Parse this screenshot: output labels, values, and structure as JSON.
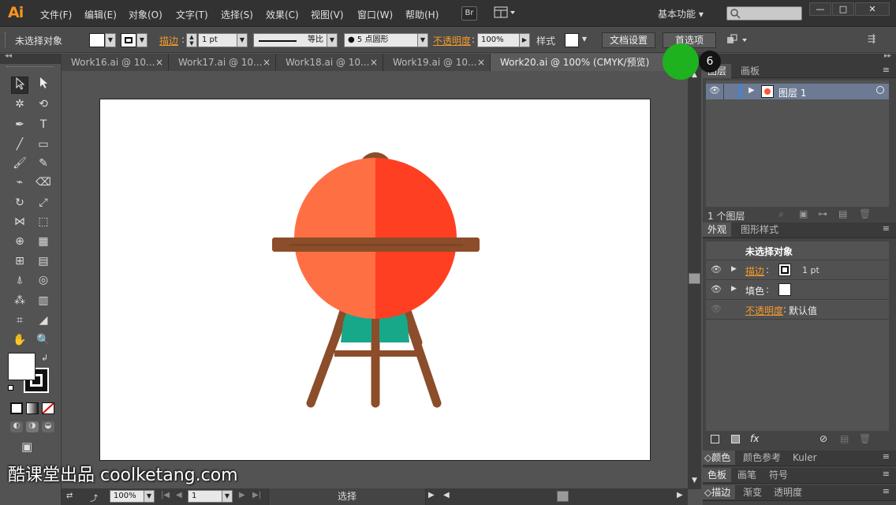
{
  "app": {
    "logo": "Ai",
    "bridge_label": "Br",
    "workspace": "基本功能"
  },
  "menu": [
    "文件(F)",
    "编辑(E)",
    "对象(O)",
    "文字(T)",
    "选择(S)",
    "效果(C)",
    "视图(V)",
    "窗口(W)",
    "帮助(H)"
  ],
  "window_buttons": [
    "—",
    "□",
    "✕"
  ],
  "control": {
    "selection_status": "未选择对象",
    "stroke_label": "描边",
    "stroke_weight": "1 pt",
    "profile_label": "等比",
    "brush_label": "5 点圆形",
    "opacity_label": "不透明度",
    "opacity_value": "100%",
    "style_label": "样式",
    "doc_setup_button": "文档设置",
    "prefs_button": "首选项"
  },
  "tabs": [
    {
      "label": "Work16.ai @ 10...",
      "active": false
    },
    {
      "label": "Work17.ai @ 10...",
      "active": false
    },
    {
      "label": "Work18.ai @ 10...",
      "active": false
    },
    {
      "label": "Work19.ai @ 10...",
      "active": false
    },
    {
      "label": "Work20.ai @ 100% (CMYK/预览)",
      "active": true
    }
  ],
  "tab_close": "×",
  "step_badge": "6",
  "layers_panel": {
    "tabs": [
      "图层",
      "画板"
    ],
    "layer_name": "图层 1",
    "footer_count": "1 个图层"
  },
  "appearance_panel": {
    "tabs": [
      "外观",
      "图形样式"
    ],
    "title": "未选择对象",
    "stroke_label": "描边",
    "stroke_value": "1 pt",
    "fill_label": "填色",
    "opacity_label": "不透明度",
    "opacity_value": "默认值",
    "fx_label": "fx"
  },
  "bottom_panels": {
    "row1": [
      "颜色",
      "颜色参考",
      "Kuler"
    ],
    "row2": [
      "色板",
      "画笔",
      "符号"
    ],
    "row3": [
      "描边",
      "渐变",
      "透明度"
    ]
  },
  "status": {
    "zoom": "100%",
    "page": "1",
    "tool": "选择"
  },
  "watermark": "酷课堂出品 coolketang.com",
  "colors": {
    "grill_left": "#ff6f44",
    "grill_right": "#ff3f22",
    "wood": "#8b4d2a",
    "teal": "#17a88a",
    "accent_orange": "#f39a2b"
  }
}
